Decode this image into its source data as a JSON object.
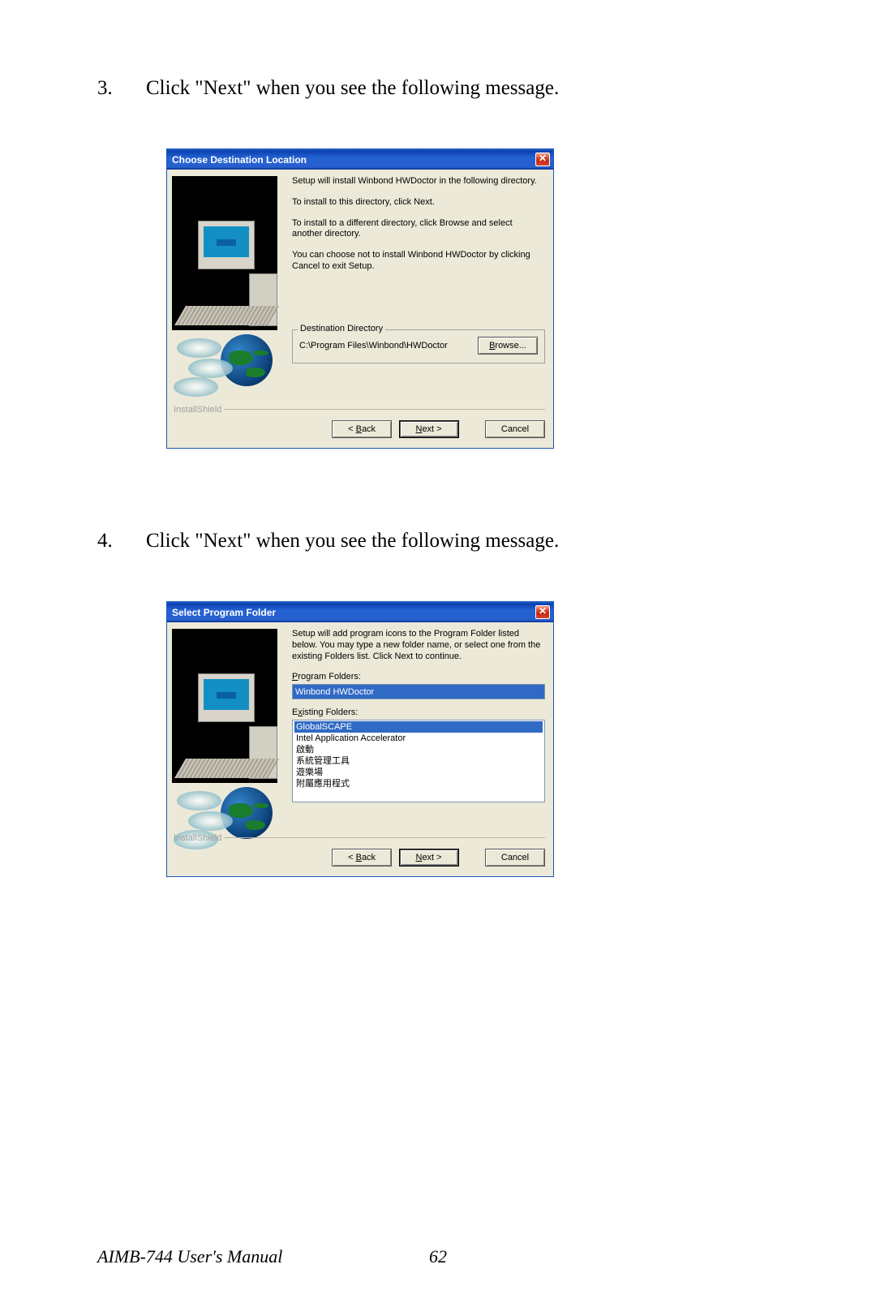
{
  "steps": {
    "s3_num": "3.",
    "s3_text": "Click \"Next\" when you see the following message.",
    "s4_num": "4.",
    "s4_text": "Click \"Next\" when you see the following message."
  },
  "dialog1": {
    "title": "Choose Destination Location",
    "close": "✕",
    "p1": "Setup will install Winbond HWDoctor in the following directory.",
    "p2": "To install to this directory, click Next.",
    "p3": "To install to a different directory, click Browse and select another directory.",
    "p4": "You can choose not to install Winbond HWDoctor by clicking Cancel to exit Setup.",
    "dest_legend": "Destination Directory",
    "dest_path": "C:\\Program Files\\Winbond\\HWDoctor",
    "browse": "Browse...",
    "shield": "InstallShield",
    "back": "< Back",
    "next": "Next >",
    "cancel": "Cancel"
  },
  "dialog2": {
    "title": "Select Program Folder",
    "close": "✕",
    "p1": "Setup will add program icons to the Program Folder listed below. You may type a new folder name, or select one from the existing Folders list.  Click Next to continue.",
    "pf_label": "Program Folders:",
    "pf_value": "Winbond HWDoctor",
    "ef_label": "Existing Folders:",
    "ef_items": [
      "GlobalSCAPE",
      "Intel Application Accelerator",
      "啟動",
      "系統管理工具",
      "遊樂場",
      "附屬應用程式"
    ],
    "shield": "InstallShield",
    "back": "< Back",
    "next": "Next >",
    "cancel": "Cancel"
  },
  "footer": {
    "manual": "AIMB-744 User's Manual",
    "page": "62"
  }
}
